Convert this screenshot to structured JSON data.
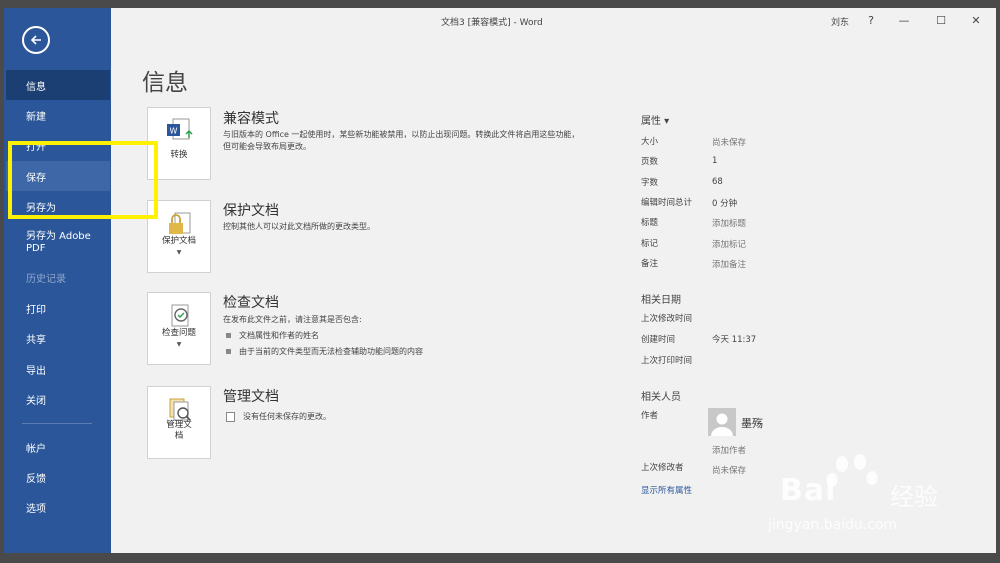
{
  "window": {
    "title": "文档3 [兼容模式]  -  Word",
    "user": "刘东",
    "help": "?",
    "minimize": "—",
    "maximize": "☐",
    "close": "✕"
  },
  "sidebar": {
    "items": [
      {
        "label": "信息"
      },
      {
        "label": "新建"
      },
      {
        "label": "打开"
      },
      {
        "label": "保存"
      },
      {
        "label": "另存为"
      },
      {
        "label": "另存为 Adobe PDF"
      },
      {
        "label": "历史记录"
      },
      {
        "label": "打印"
      },
      {
        "label": "共享"
      },
      {
        "label": "导出"
      },
      {
        "label": "关闭"
      },
      {
        "label": "帐户"
      },
      {
        "label": "反馈"
      },
      {
        "label": "选项"
      }
    ]
  },
  "main": {
    "title": "信息",
    "compat": {
      "button": "转换",
      "title": "兼容模式",
      "desc": "与旧版本的 Office 一起使用时，某些新功能被禁用，以防止出现问题。转换此文件将启用这些功能，但可能会导致布局更改。"
    },
    "protect": {
      "button": "保护文档",
      "title": "保护文档",
      "desc": "控制其他人可以对此文档所做的更改类型。"
    },
    "inspect": {
      "button": "检查问题",
      "title": "检查文档",
      "desc": "在发布此文件之前，请注意其是否包含:",
      "bullets": [
        "文档属性和作者的姓名",
        "由于当前的文件类型而无法检查辅助功能问题的内容"
      ]
    },
    "manage": {
      "button_line1": "管理文",
      "button_line2": "档",
      "title": "管理文档",
      "desc": "没有任何未保存的更改。"
    }
  },
  "properties": {
    "heading": "属性 ▾",
    "rows": [
      {
        "label": "大小",
        "value": "尚未保存"
      },
      {
        "label": "页数",
        "value": "1"
      },
      {
        "label": "字数",
        "value": "68"
      },
      {
        "label": "编辑时间总计",
        "value": "0 分钟"
      },
      {
        "label": "标题",
        "value": "添加标题"
      },
      {
        "label": "标记",
        "value": "添加标记"
      },
      {
        "label": "备注",
        "value": "添加备注"
      }
    ],
    "dates_heading": "相关日期",
    "dates": [
      {
        "label": "上次修改时间",
        "value": ""
      },
      {
        "label": "创建时间",
        "value": "今天 11:37"
      },
      {
        "label": "上次打印时间",
        "value": ""
      }
    ],
    "people_heading": "相关人员",
    "author_label": "作者",
    "author_name": "墨殇",
    "add_author": "添加作者",
    "last_modified_by_label": "上次修改者",
    "last_modified_by_value": "尚未保存",
    "show_all": "显示所有属性"
  },
  "watermark": {
    "brand": "Bai",
    "brand2": "经验",
    "url": "jingyan.baidu.com"
  },
  "colors": {
    "sidebar": "#2b579a",
    "sidebar_active": "#1c3f73",
    "highlight": "#fff200"
  }
}
